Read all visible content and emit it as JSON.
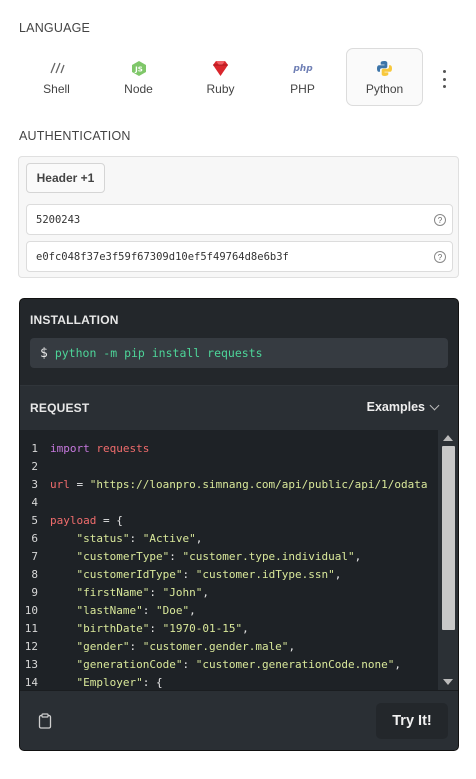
{
  "language_section": {
    "label": "LANGUAGE",
    "options": [
      {
        "name": "Shell",
        "icon": "shell-icon",
        "active": false
      },
      {
        "name": "Node",
        "icon": "node-icon",
        "active": false
      },
      {
        "name": "Ruby",
        "icon": "ruby-icon",
        "active": false
      },
      {
        "name": "PHP",
        "icon": "php-icon",
        "active": false
      },
      {
        "name": "Python",
        "icon": "python-icon",
        "active": true
      }
    ],
    "more_icon": "more-vertical-icon"
  },
  "auth_section": {
    "label": "AUTHENTICATION",
    "tab_label": "Header +1",
    "field_1_value": "5200243",
    "field_2_value": "e0fc048f37e3f59f67309d10ef5f49764d8e6b3f",
    "help_glyph": "?"
  },
  "installation": {
    "title": "INSTALLATION",
    "prompt": "$",
    "command": "python -m pip install requests"
  },
  "request": {
    "title": "REQUEST",
    "examples_label": "Examples",
    "code_lines": [
      {
        "n": "1",
        "parts": [
          [
            "kw",
            "import"
          ],
          [
            "",
            " "
          ],
          [
            "mod",
            "requests"
          ]
        ]
      },
      {
        "n": "2",
        "parts": []
      },
      {
        "n": "3",
        "parts": [
          [
            "var",
            "url"
          ],
          [
            "",
            " = "
          ],
          [
            "str",
            "\"https://loanpro.simnang.com/api/public/api/1/odata"
          ]
        ]
      },
      {
        "n": "4",
        "parts": []
      },
      {
        "n": "5",
        "parts": [
          [
            "var",
            "payload"
          ],
          [
            "",
            " = {"
          ]
        ]
      },
      {
        "n": "6",
        "parts": [
          [
            "",
            "    "
          ],
          [
            "str",
            "\"status\""
          ],
          [
            "",
            ": "
          ],
          [
            "str",
            "\"Active\""
          ],
          [
            "",
            ","
          ]
        ]
      },
      {
        "n": "7",
        "parts": [
          [
            "",
            "    "
          ],
          [
            "str",
            "\"customerType\""
          ],
          [
            "",
            ": "
          ],
          [
            "str",
            "\"customer.type.individual\""
          ],
          [
            "",
            ","
          ]
        ]
      },
      {
        "n": "8",
        "parts": [
          [
            "",
            "    "
          ],
          [
            "str",
            "\"customerIdType\""
          ],
          [
            "",
            ": "
          ],
          [
            "str",
            "\"customer.idType.ssn\""
          ],
          [
            "",
            ","
          ]
        ]
      },
      {
        "n": "9",
        "parts": [
          [
            "",
            "    "
          ],
          [
            "str",
            "\"firstName\""
          ],
          [
            "",
            ": "
          ],
          [
            "str",
            "\"John\""
          ],
          [
            "",
            ","
          ]
        ]
      },
      {
        "n": "10",
        "parts": [
          [
            "",
            "    "
          ],
          [
            "str",
            "\"lastName\""
          ],
          [
            "",
            ": "
          ],
          [
            "str",
            "\"Doe\""
          ],
          [
            "",
            ","
          ]
        ]
      },
      {
        "n": "11",
        "parts": [
          [
            "",
            "    "
          ],
          [
            "str",
            "\"birthDate\""
          ],
          [
            "",
            ": "
          ],
          [
            "str",
            "\"1970-01-15\""
          ],
          [
            "",
            ","
          ]
        ]
      },
      {
        "n": "12",
        "parts": [
          [
            "",
            "    "
          ],
          [
            "str",
            "\"gender\""
          ],
          [
            "",
            ": "
          ],
          [
            "str",
            "\"customer.gender.male\""
          ],
          [
            "",
            ","
          ]
        ]
      },
      {
        "n": "13",
        "parts": [
          [
            "",
            "    "
          ],
          [
            "str",
            "\"generationCode\""
          ],
          [
            "",
            ": "
          ],
          [
            "str",
            "\"customer.generationCode.none\""
          ],
          [
            "",
            ","
          ]
        ]
      },
      {
        "n": "14",
        "parts": [
          [
            "",
            "    "
          ],
          [
            "str",
            "\"Employer\""
          ],
          [
            "",
            ": {"
          ]
        ]
      }
    ]
  },
  "footer": {
    "copy_icon": "clipboard-icon",
    "try_label": "Try It!"
  },
  "colors": {
    "panel_bg": "#23272b",
    "code_bg": "#1e2226",
    "command_green": "#4dd599",
    "keyword_purple": "#c678dd",
    "string_yellow": "#d9e89a",
    "variable_red": "#f06c6c"
  }
}
